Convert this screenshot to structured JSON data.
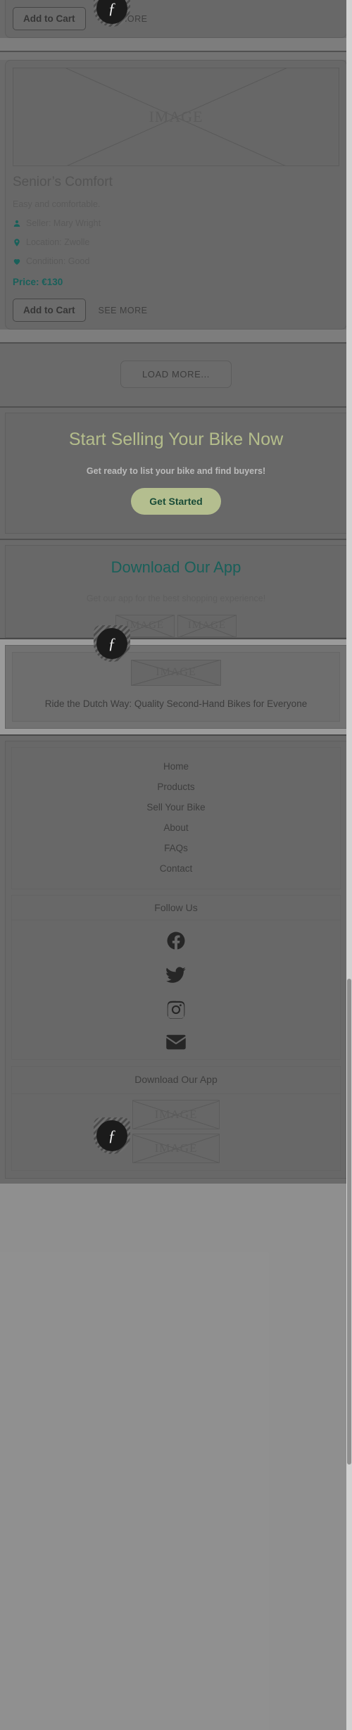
{
  "product": {
    "image_placeholder": "IMAGE",
    "title": "Senior’s Comfort",
    "description": "Easy and comfortable.",
    "seller_label": "Seller: Mary Wright",
    "location_label": "Location: Zwolle",
    "condition_label": "Condition: Good",
    "price_label": "Price: €130",
    "add_to_cart": "Add to Cart",
    "see_more": "SEE MORE"
  },
  "product_top": {
    "add_to_cart": "Add to Cart",
    "see_more": "SEE MORE"
  },
  "load_more": {
    "label": "LOAD MORE..."
  },
  "cta": {
    "title": "Start Selling Your Bike Now",
    "subtitle": "Get ready to list your bike and find buyers!",
    "button": "Get Started"
  },
  "download_mid": {
    "title": "Download Our App",
    "subtitle": "Get our app for the best shopping experience!",
    "badge_1": "IMAGE",
    "badge_2": "IMAGE"
  },
  "article": {
    "image_placeholder": "IMAGE",
    "title": "Ride the Dutch Way: Quality Second-Hand Bikes for Everyone"
  },
  "footer": {
    "nav": [
      {
        "label": "Home"
      },
      {
        "label": "Products"
      },
      {
        "label": "Sell Your Bike"
      },
      {
        "label": "About"
      },
      {
        "label": "FAQs"
      },
      {
        "label": "Contact"
      }
    ],
    "follow_title": "Follow Us",
    "social": [
      {
        "name": "facebook"
      },
      {
        "name": "twitter"
      },
      {
        "name": "instagram"
      },
      {
        "name": "email"
      }
    ],
    "download_title": "Download Our App",
    "badge_1": "IMAGE",
    "badge_2": "IMAGE"
  },
  "overlay": {
    "badge_glyph": "ƒ"
  },
  "colors": {
    "teal": "#0b7068",
    "cta_yellow": "#e8f5ae",
    "button_green_bg": "#e9f7b4",
    "button_green_text": "#0a5235"
  }
}
